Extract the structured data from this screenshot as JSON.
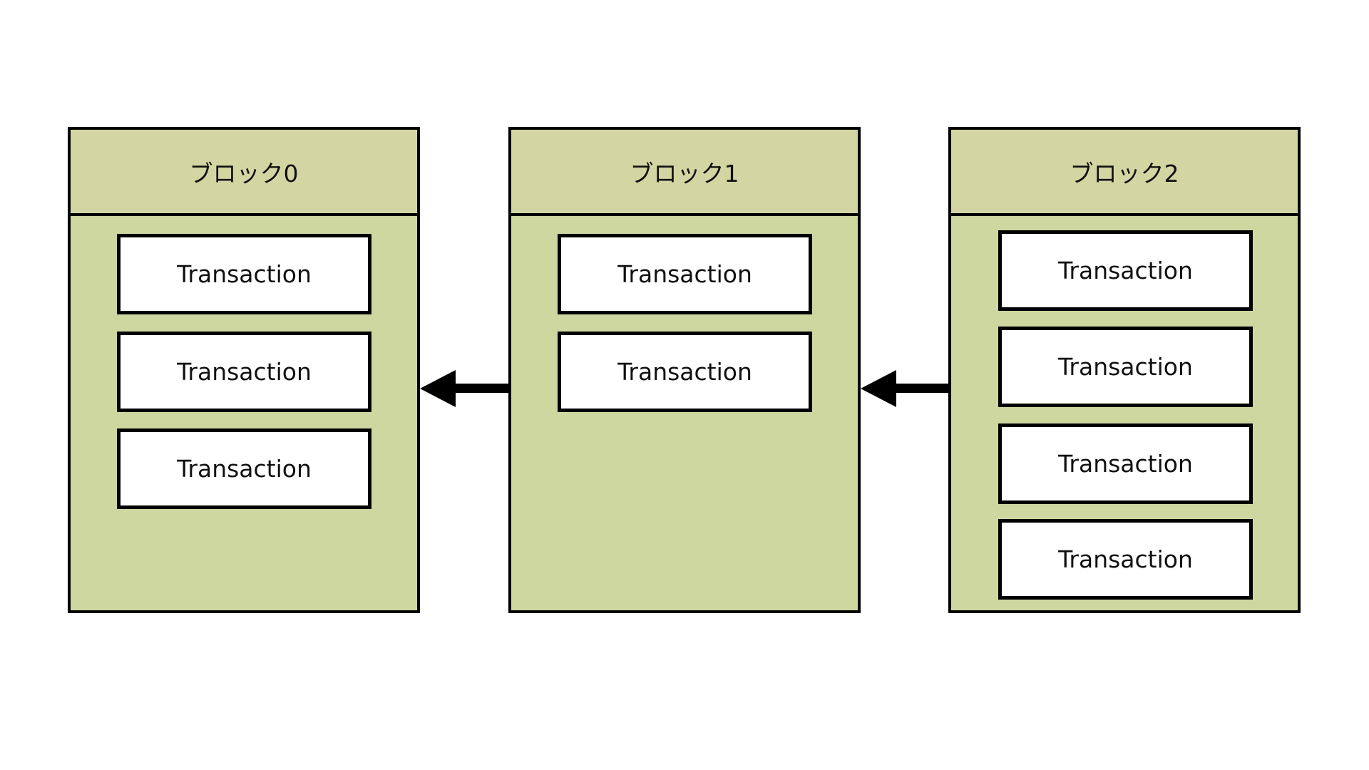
{
  "diagram": {
    "title": "",
    "colors": {
      "block_fill": "#cdd79f",
      "header_fill": "#d3d6a2",
      "stroke": "#000000",
      "tx_fill": "#ffffff"
    },
    "blocks": [
      {
        "label": "ブロック0",
        "transactions": [
          "Transaction",
          "Transaction",
          "Transaction"
        ]
      },
      {
        "label": "ブロック1",
        "transactions": [
          "Transaction",
          "Transaction"
        ]
      },
      {
        "label": "ブロック2",
        "transactions": [
          "Transaction",
          "Transaction",
          "Transaction",
          "Transaction"
        ]
      }
    ],
    "edges": [
      {
        "from": "ブロック1",
        "to": "ブロック0",
        "type": "arrow"
      },
      {
        "from": "ブロック2",
        "to": "ブロック1",
        "type": "arrow"
      }
    ]
  }
}
